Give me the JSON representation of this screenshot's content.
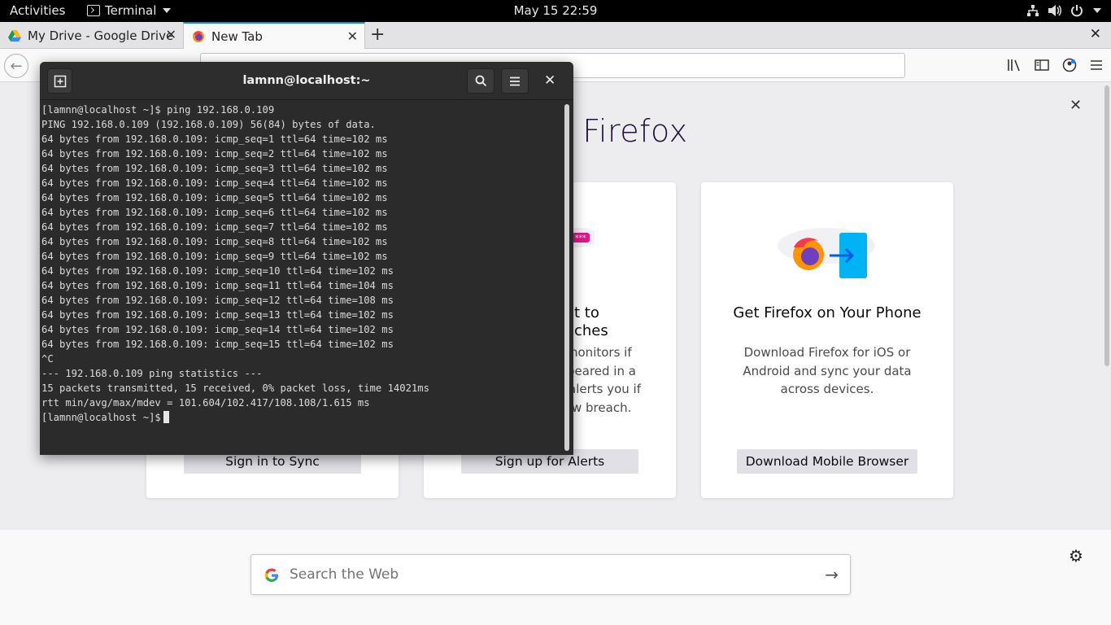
{
  "topbar": {
    "activities": "Activities",
    "app_menu": "Terminal",
    "clock": "May 15  22:59",
    "icons": [
      "network-icon",
      "volume-icon",
      "power-icon",
      "chevron-down-icon"
    ]
  },
  "browser": {
    "tabs": [
      {
        "title": "My Drive - Google Drive",
        "icon": "google-drive-icon",
        "active": false
      },
      {
        "title": "New Tab",
        "icon": "firefox-icon",
        "active": true
      }
    ],
    "url_placeholder": ""
  },
  "newtab": {
    "welcome_title": "o Firefox",
    "cards": [
      {
        "title": "",
        "text": "",
        "button": "Sign in to Sync"
      },
      {
        "title": "t to\nches",
        "text_lines": [
          "nonitors if",
          "peared in a",
          "alerts you if",
          "w breach."
        ],
        "button": "Sign up for Alerts"
      },
      {
        "title": "Get Firefox on Your Phone",
        "text": "Download Firefox for iOS or Android and sync your data across devices.",
        "button": "Download Mobile Browser"
      }
    ],
    "search_placeholder": "Search the Web"
  },
  "terminal": {
    "title": "lamnn@localhost:~",
    "lines": [
      "[lamnn@localhost ~]$ ping 192.168.0.109",
      "PING 192.168.0.109 (192.168.0.109) 56(84) bytes of data.",
      "64 bytes from 192.168.0.109: icmp_seq=1 ttl=64 time=102 ms",
      "64 bytes from 192.168.0.109: icmp_seq=2 ttl=64 time=102 ms",
      "64 bytes from 192.168.0.109: icmp_seq=3 ttl=64 time=102 ms",
      "64 bytes from 192.168.0.109: icmp_seq=4 ttl=64 time=102 ms",
      "64 bytes from 192.168.0.109: icmp_seq=5 ttl=64 time=102 ms",
      "64 bytes from 192.168.0.109: icmp_seq=6 ttl=64 time=102 ms",
      "64 bytes from 192.168.0.109: icmp_seq=7 ttl=64 time=102 ms",
      "64 bytes from 192.168.0.109: icmp_seq=8 ttl=64 time=102 ms",
      "64 bytes from 192.168.0.109: icmp_seq=9 ttl=64 time=102 ms",
      "64 bytes from 192.168.0.109: icmp_seq=10 ttl=64 time=102 ms",
      "64 bytes from 192.168.0.109: icmp_seq=11 ttl=64 time=104 ms",
      "64 bytes from 192.168.0.109: icmp_seq=12 ttl=64 time=108 ms",
      "64 bytes from 192.168.0.109: icmp_seq=13 ttl=64 time=102 ms",
      "64 bytes from 192.168.0.109: icmp_seq=14 ttl=64 time=102 ms",
      "64 bytes from 192.168.0.109: icmp_seq=15 ttl=64 time=102 ms",
      "^C",
      "--- 192.168.0.109 ping statistics ---",
      "15 packets transmitted, 15 received, 0% packet loss, time 14021ms",
      "rtt min/avg/max/mdev = 101.604/102.417/108.108/1.615 ms"
    ],
    "prompt": "[lamnn@localhost ~]$"
  },
  "colors": {
    "firefox_accent": "#0a84ff",
    "terminal_bg": "#2b2b2b",
    "topbar_bg": "#000000"
  }
}
